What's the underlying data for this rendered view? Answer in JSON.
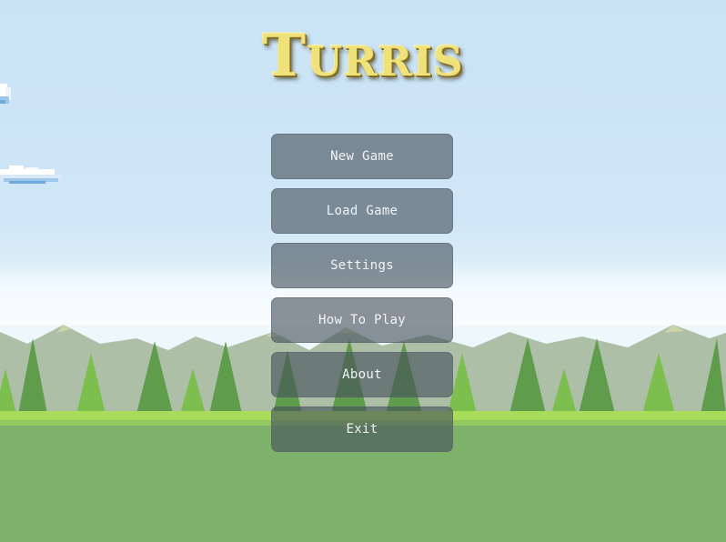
{
  "game": {
    "title": "Turris"
  },
  "menu": {
    "items": [
      {
        "id": "new-game",
        "label": "New Game"
      },
      {
        "id": "load-game",
        "label": "Load Game"
      },
      {
        "id": "settings",
        "label": "Settings"
      },
      {
        "id": "how-to-play",
        "label": "How To Play"
      },
      {
        "id": "about",
        "label": "About"
      },
      {
        "id": "exit",
        "label": "Exit"
      }
    ]
  },
  "colors": {
    "sky": "#cfe6f6",
    "title": "#efe27a",
    "button_bg": "#505a64",
    "button_text": "#f2f4f5",
    "grass": "#7eb26a",
    "grass_highlight": "#a9dc5a",
    "tree_dark": "#5a9a46",
    "tree_light": "#7cbd4e",
    "mountain": "#a9bca4"
  }
}
